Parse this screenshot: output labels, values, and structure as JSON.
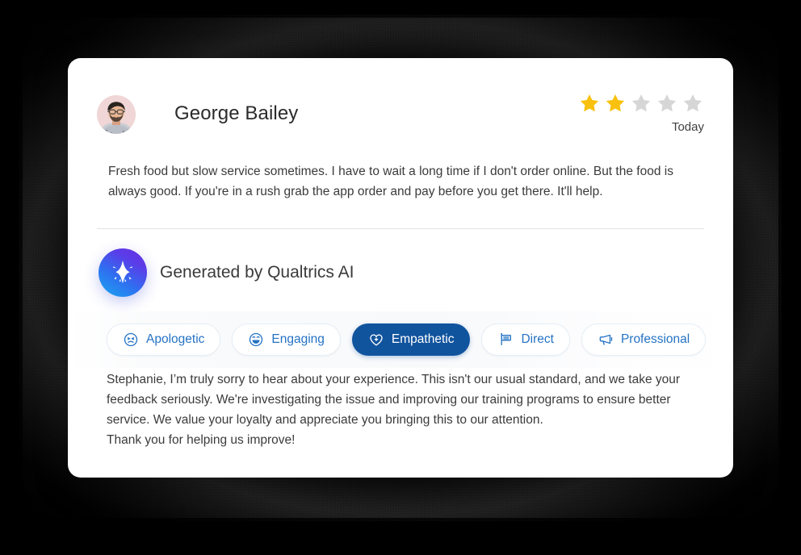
{
  "review": {
    "reviewer_name": "George Bailey",
    "avatar_alt": "reviewer-photo",
    "rating": 2,
    "rating_max": 5,
    "date": "Today",
    "text": "Fresh food but slow service sometimes. I have to wait a long time if I don't order online. But the food is always good. If you're in a rush grab the app order and pay before you get there. It'll help."
  },
  "ai_section": {
    "title": "Generated by Qualtrics AI",
    "logo_icon": "sparkle-icon",
    "tones": [
      {
        "label": "Apologetic",
        "icon": "frowning-face-icon",
        "selected": false
      },
      {
        "label": "Engaging",
        "icon": "laughing-face-icon",
        "selected": false
      },
      {
        "label": "Empathetic",
        "icon": "heart-plus-icon",
        "selected": true
      },
      {
        "label": "Direct",
        "icon": "signpost-icon",
        "selected": false
      },
      {
        "label": "Professional",
        "icon": "megaphone-icon",
        "selected": false
      }
    ],
    "response_paragraphs": [
      "Stephanie, I’m truly sorry to hear about your experience. This isn't our usual standard, and we take your feedback seriously. We're investigating the issue and improving our training programs to ensure better service. We value your loyalty and appreciate you bringing this to our attention.",
      "Thank you for helping us improve!"
    ]
  },
  "colors": {
    "star_filled": "#F9C10D",
    "star_empty": "#D6D6D6",
    "chip_text": "#2573C4",
    "chip_selected_bg": "#11549E",
    "card_bg": "#FFFFFF",
    "page_bg": "#000000"
  }
}
